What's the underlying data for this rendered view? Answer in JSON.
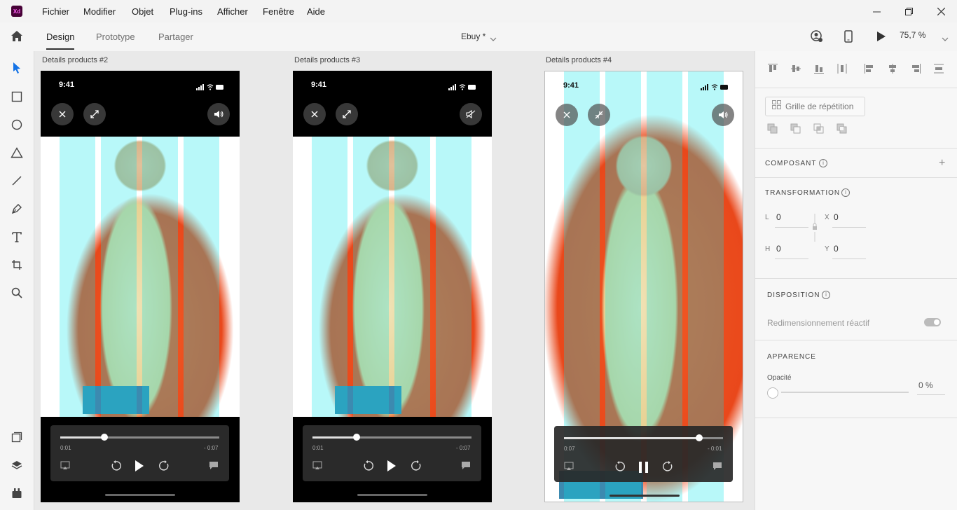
{
  "app": {
    "logo_text": "Xd"
  },
  "menu": [
    "Fichier",
    "Modifier",
    "Objet",
    "Plug-ins",
    "Afficher",
    "Fenêtre",
    "Aide"
  ],
  "tabs": {
    "design": "Design",
    "prototype": "Prototype",
    "share": "Partager"
  },
  "document": {
    "name": "Ebuy *"
  },
  "zoom": {
    "value": "75,7 %"
  },
  "artboards": [
    {
      "label": "Details products #2",
      "time": "9:41",
      "elapsed": "0:01",
      "remaining": "- 0:07",
      "progress": 0.25,
      "state": "paused",
      "sound": "on"
    },
    {
      "label": "Details products #3",
      "time": "9:41",
      "elapsed": "0:01",
      "remaining": "- 0:07",
      "progress": 0.25,
      "state": "paused",
      "sound": "muted"
    },
    {
      "label": "Details products #4",
      "time": "9:41",
      "elapsed": "0:07",
      "remaining": "- 0:01",
      "progress": 0.85,
      "state": "playing",
      "sound": "on"
    }
  ],
  "panel": {
    "repeat_grid": "Grille de répétition",
    "component": "COMPOSANT",
    "transform": "TRANSFORMATION",
    "w_label": "L",
    "w_value": "0",
    "h_label": "H",
    "h_value": "0",
    "x_label": "X",
    "x_value": "0",
    "y_label": "Y",
    "y_value": "0",
    "layout": "DISPOSITION",
    "responsive": "Redimensionnement réactif",
    "appearance": "APPARENCE",
    "opacity_label": "Opacité",
    "opacity_value": "0 %"
  },
  "colors": {
    "accent": "#1473e6",
    "overlay": "#00e6eb",
    "hoodie": "#f15a25",
    "xd_logo_bg": "#470137"
  }
}
